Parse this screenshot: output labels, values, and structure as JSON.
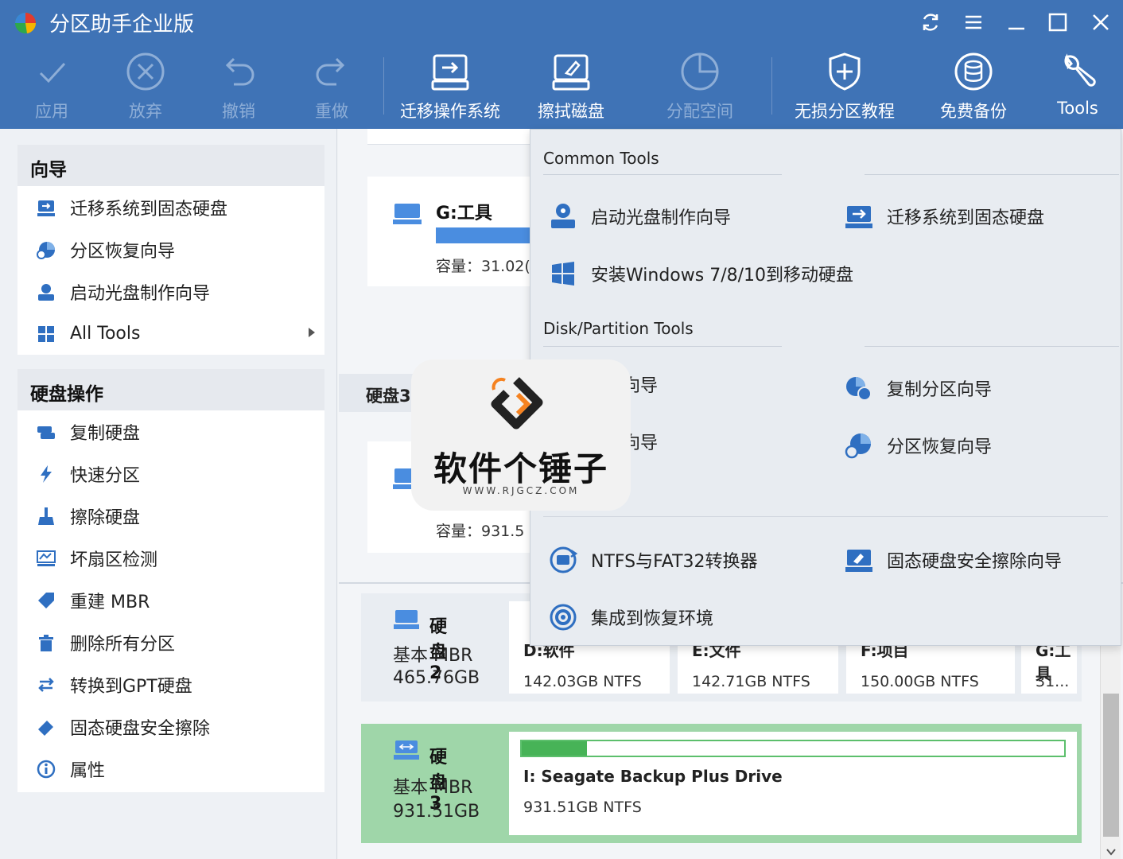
{
  "app": {
    "title": "分区助手企业版"
  },
  "toolbar": {
    "apply": "应用",
    "discard": "放弃",
    "undo": "撤销",
    "redo": "重做",
    "migrate_os": "迁移操作系统",
    "wipe_disk": "擦拭磁盘",
    "allocate_space": "分配空间",
    "tutorial": "无损分区教程",
    "backup": "免费备份",
    "tools": "Tools"
  },
  "sidebar": {
    "wizard_title": "向导",
    "wizard_items": [
      "迁移系统到固态硬盘",
      "分区恢复向导",
      "启动光盘制作向导",
      "All Tools"
    ],
    "disk_ops_title": "硬盘操作",
    "disk_ops_items": [
      "复制硬盘",
      "快速分区",
      "擦除硬盘",
      "坏扇区检测",
      "重建 MBR",
      "删除所有分区",
      "转换到GPT硬盘",
      "固态硬盘安全擦除",
      "属性"
    ]
  },
  "main": {
    "partition_g": {
      "name": "G:工具",
      "capacity": "容量：31.02("
    },
    "disk3_header": "硬盘3",
    "partition_other": {
      "capacity": "容量：931.5"
    },
    "disk2": {
      "name": "硬盘2",
      "type": "基本 MBR",
      "size": "465.76GB",
      "partitions": [
        {
          "name": "D:软件",
          "size": "142.03GB NTFS"
        },
        {
          "name": "E:文件",
          "size": "142.71GB NTFS"
        },
        {
          "name": "F:项目",
          "size": "150.00GB NTFS"
        },
        {
          "name": "G:工具",
          "size": "31..."
        }
      ]
    },
    "disk3": {
      "name": "硬盘3",
      "type": "基本 MBR",
      "size": "931.51GB",
      "partition": {
        "name": "I: Seagate Backup Plus Drive",
        "size": "931.51GB NTFS"
      },
      "usage_fraction": 0.12
    }
  },
  "tools_menu": {
    "common_title": "Common Tools",
    "common_items": [
      "启动光盘制作向导",
      "迁移系统到固态硬盘",
      "安装Windows 7/8/10到移动硬盘"
    ],
    "disk_title": "Disk/Partition Tools",
    "disk_items": [
      "硬盘向导",
      "复制分区向导",
      "分区向导",
      "分区恢复向导",
      "NTFS与FAT32转换器",
      "固态硬盘安全擦除向导",
      "集成到恢复环境"
    ]
  },
  "watermark": {
    "name": "软件个锤子",
    "url": "WWW.RJGCZ.COM"
  },
  "colors": {
    "toolbar_bg": "#3f73b6",
    "selected_disk": "#9fd6a9",
    "bar": "#4a8de0"
  }
}
